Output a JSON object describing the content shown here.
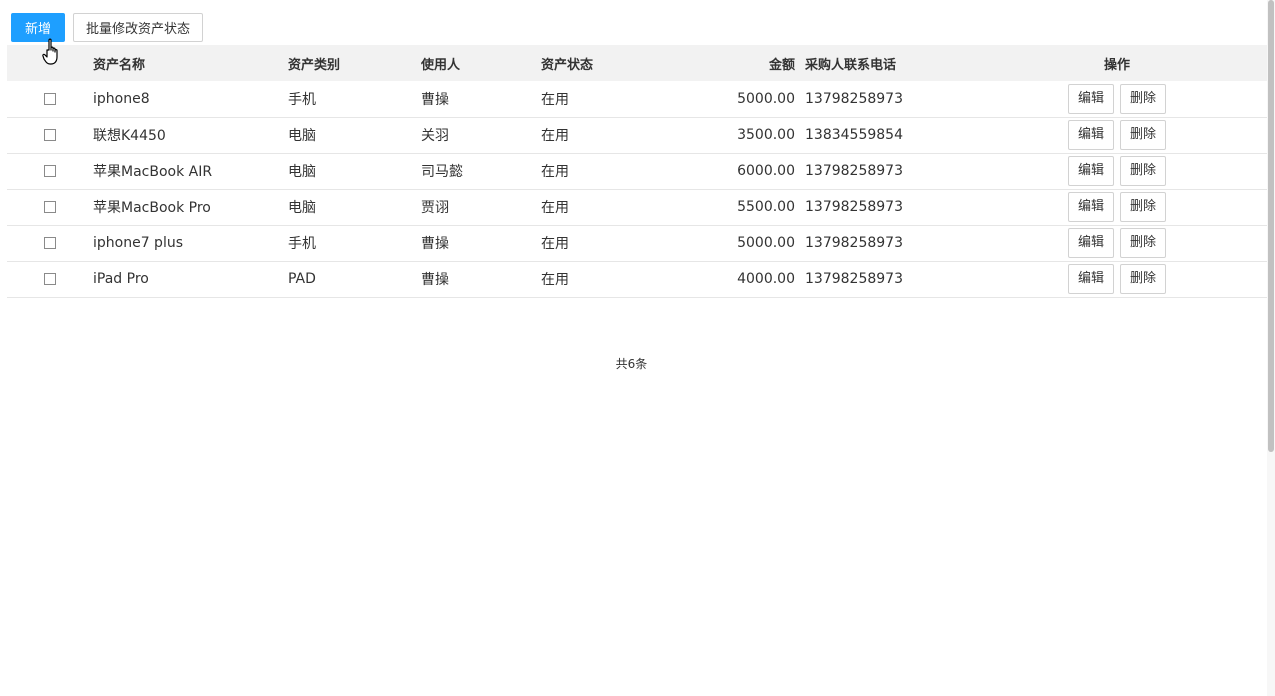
{
  "toolbar": {
    "add_label": "新增",
    "batch_label": "批量修改资产状态"
  },
  "colors": {
    "primary": "#1e9fff",
    "header_bg": "#f2f2f2",
    "border": "#e6e6e6"
  },
  "table": {
    "headers": {
      "name": "资产名称",
      "category": "资产类别",
      "user": "使用人",
      "status": "资产状态",
      "amount": "金额",
      "phone": "采购人联系电话",
      "ops": "操作"
    },
    "rows": [
      {
        "name": "iphone8",
        "category": "手机",
        "user": "曹操",
        "status": "在用",
        "amount": "5000.00",
        "phone": "13798258973"
      },
      {
        "name": "联想K4450",
        "category": "电脑",
        "user": "关羽",
        "status": "在用",
        "amount": "3500.00",
        "phone": "13834559854"
      },
      {
        "name": "苹果MacBook AIR",
        "category": "电脑",
        "user": "司马懿",
        "status": "在用",
        "amount": "6000.00",
        "phone": "13798258973"
      },
      {
        "name": "苹果MacBook Pro",
        "category": "电脑",
        "user": "贾诩",
        "status": "在用",
        "amount": "5500.00",
        "phone": "13798258973"
      },
      {
        "name": "iphone7 plus",
        "category": "手机",
        "user": "曹操",
        "status": "在用",
        "amount": "5000.00",
        "phone": "13798258973"
      },
      {
        "name": "iPad Pro",
        "category": "PAD",
        "user": "曹操",
        "status": "在用",
        "amount": "4000.00",
        "phone": "13798258973"
      }
    ],
    "edit_label": "编辑",
    "delete_label": "删除"
  },
  "footer": {
    "total_text": "共6条"
  }
}
